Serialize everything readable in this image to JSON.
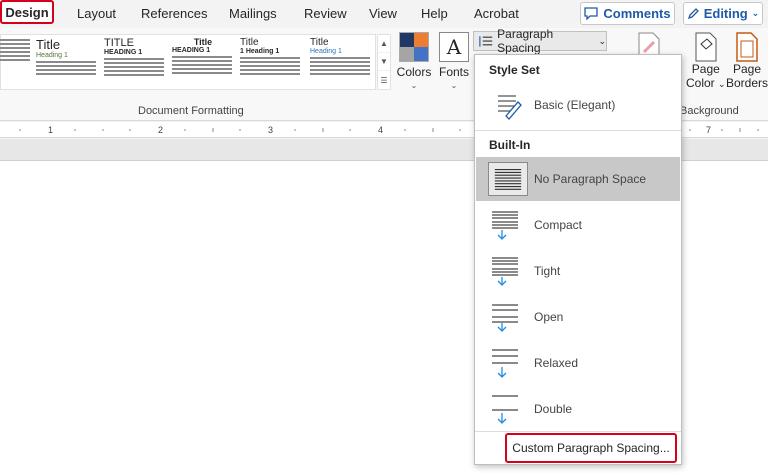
{
  "tabs": [
    {
      "label": "Design",
      "active": true
    },
    {
      "label": "Layout"
    },
    {
      "label": "References"
    },
    {
      "label": "Mailings"
    },
    {
      "label": "Review"
    },
    {
      "label": "View"
    },
    {
      "label": "Help"
    },
    {
      "label": "Acrobat"
    }
  ],
  "topright": {
    "comments_label": "Comments",
    "editing_label": "Editing"
  },
  "gallery": {
    "items": [
      {
        "title": "",
        "heading": ""
      },
      {
        "title": "Title",
        "heading": "Heading 1"
      },
      {
        "title": "TITLE",
        "heading": "HEADING 1"
      },
      {
        "title": "Title",
        "heading": "HEADING 1"
      },
      {
        "title": "Title",
        "heading": "1   Heading 1"
      },
      {
        "title": "Title",
        "heading": "Heading 1"
      }
    ]
  },
  "groups": {
    "document_formatting": "Document Formatting",
    "background": "Background"
  },
  "ribbon_buttons": {
    "colors_label": "Colors",
    "fonts_label": "Fonts",
    "fonts_glyph": "A",
    "paragraph_spacing_label": "Paragraph Spacing",
    "page_color_label": [
      "Page",
      "Color"
    ],
    "page_borders_label": [
      "Page",
      "Borders"
    ]
  },
  "colors": {
    "accent": "#1e5aa8",
    "highlight": "#d6001c",
    "swatch": [
      "#1f3864",
      "#ed7d31",
      "#a5a5a5",
      "#4472c4"
    ]
  },
  "ruler": {
    "ticks": [
      "1",
      "2",
      "3",
      "4",
      "7"
    ]
  },
  "dropdown": {
    "style_set_header": "Style Set",
    "style_set_item": "Basic (Elegant)",
    "builtin_header": "Built-In",
    "items": [
      {
        "label": "No Paragraph Space",
        "selected": true
      },
      {
        "label": "Compact"
      },
      {
        "label": "Tight"
      },
      {
        "label": "Open"
      },
      {
        "label": "Relaxed"
      },
      {
        "label": "Double"
      }
    ],
    "custom_label": "Custom Paragraph Spacing..."
  }
}
